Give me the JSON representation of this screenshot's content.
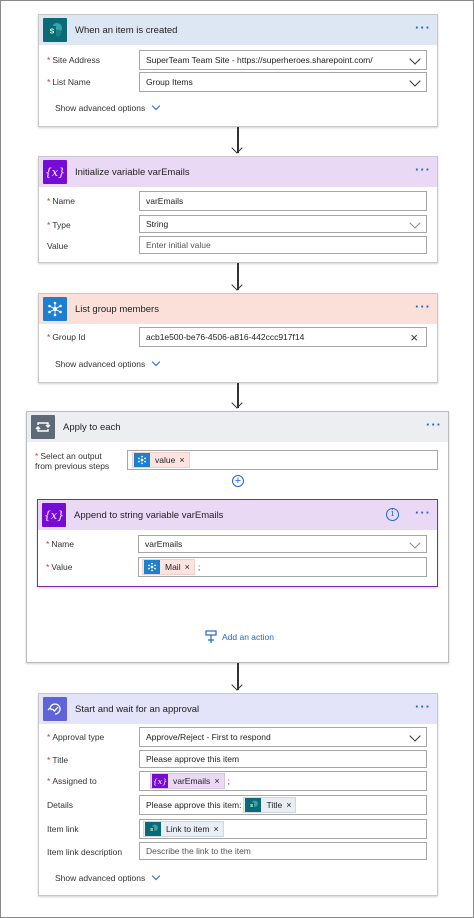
{
  "trigger": {
    "title": "When an item is created",
    "site_address_label": "Site Address",
    "site_address_value": "SuperTeam Team Site - https://superheroes.sharepoint.com/",
    "list_name_label": "List Name",
    "list_name_value": "Group Items",
    "advanced": "Show advanced options",
    "header_color": "#dde7f4"
  },
  "init_var": {
    "title": "Initialize variable varEmails",
    "name_label": "Name",
    "name_value": "varEmails",
    "type_label": "Type",
    "type_value": "String",
    "value_label": "Value",
    "value_placeholder": "Enter initial value",
    "header_color": "#ead9f5"
  },
  "list_members": {
    "title": "List group members",
    "group_id_label": "Group Id",
    "group_id_value": "acb1e500-be76-4506-a816-442ccc917f14",
    "advanced": "Show advanced options",
    "header_color": "#fbe0da"
  },
  "apply_each": {
    "title": "Apply to each",
    "select_label_line1": "Select an output",
    "select_label_line2": "from previous steps",
    "token_value": "value",
    "add_action": "Add an action",
    "header_color": "#eceef1"
  },
  "append": {
    "title": "Append to string variable varEmails",
    "name_label": "Name",
    "name_value": "varEmails",
    "value_label": "Value",
    "token_mail": "Mail",
    "value_suffix": ";",
    "header_color": "#ead9f5",
    "border_color": "#7b2ab8"
  },
  "approval": {
    "title": "Start and wait for an approval",
    "type_label": "Approval type",
    "type_value": "Approve/Reject - First to respond",
    "title_label": "Title",
    "title_value": "Please approve this item",
    "assigned_label": "Assigned to",
    "assigned_token": "varEmails",
    "assigned_suffix": ";",
    "details_label": "Details",
    "details_prefix": "Please approve this item:",
    "details_token": "Title",
    "link_label": "Item link",
    "link_token": "Link to item",
    "link_desc_label": "Item link description",
    "link_desc_placeholder": "Describe the link to the item",
    "advanced": "Show advanced options",
    "header_color": "#e3e3fa"
  },
  "icons": {
    "sharepoint": "sharepoint-icon",
    "variable": "variable-icon",
    "groups": "office-groups-icon",
    "loop": "loop-icon",
    "approval": "approval-icon",
    "info": "info-icon"
  },
  "common": {
    "remove": "×",
    "more": "···",
    "required": "*"
  }
}
